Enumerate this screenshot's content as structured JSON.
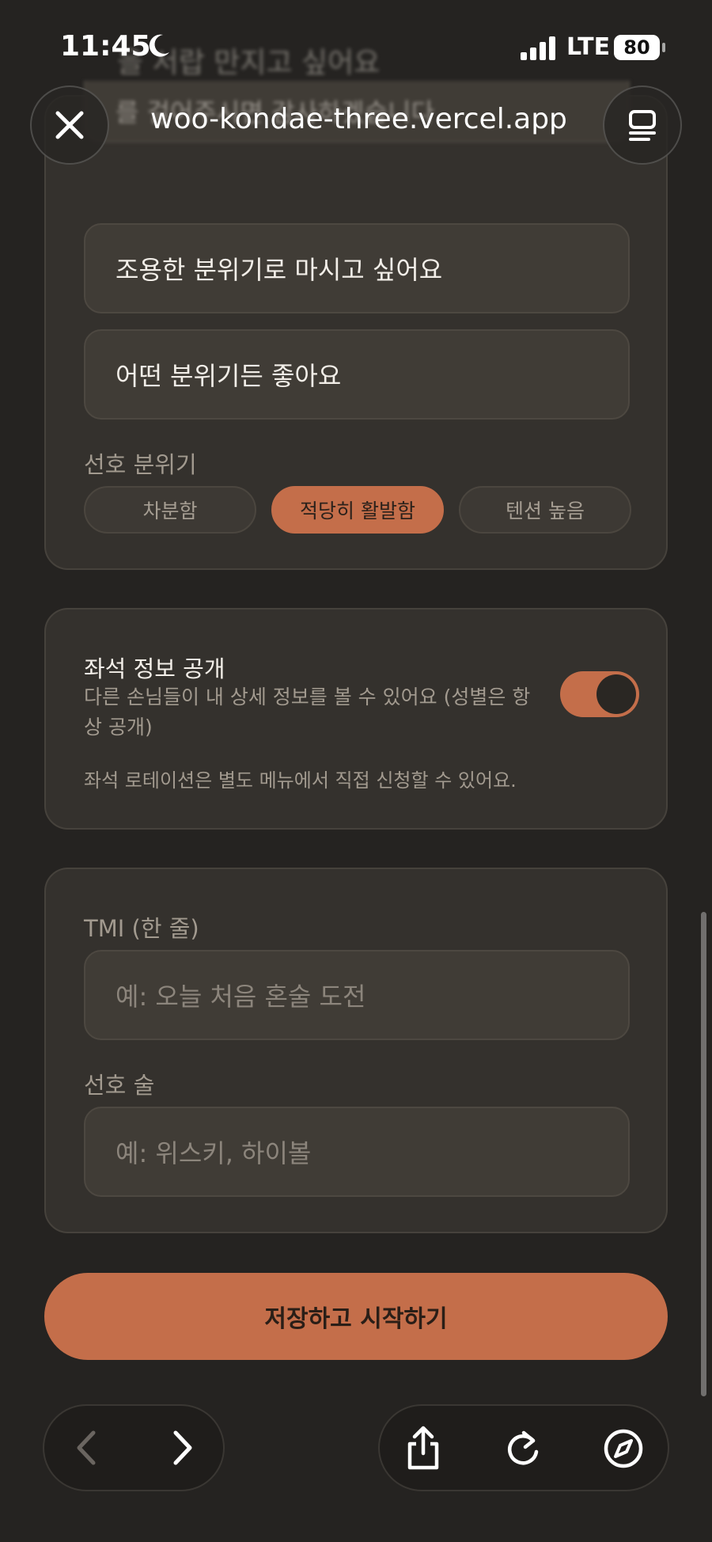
{
  "status_bar": {
    "time": "11:45",
    "network": "LTE",
    "battery": "80"
  },
  "browser": {
    "url": "woo-kondae-three.vercel.app"
  },
  "background_text": {
    "line1": "을 서랍 만지고 싶어요",
    "line2": "를 걸어주시면 감사하겠습니다"
  },
  "drink_mood_options": [
    "조용한 분위기로 마시고 싶어요",
    "어떤 분위기든 좋아요"
  ],
  "preferred_atmosphere": {
    "label": "선호 분위기",
    "options": [
      "차분함",
      "적당히 활발함",
      "텐션 높음"
    ],
    "selected": "적당히 활발함"
  },
  "seat_info": {
    "title": "좌석 정보 공개",
    "description": "다른 손님들이 내 상세 정보를 볼 수 있어요 (성별은 항상 공개)",
    "enabled": true,
    "note": "좌석 로테이션은 별도 메뉴에서 직접 신청할 수 있어요."
  },
  "profile": {
    "tmi_label": "TMI (한 줄)",
    "tmi_placeholder": "예: 오늘 처음 혼술 도전",
    "drink_label": "선호 술",
    "drink_placeholder": "예: 위스키, 하이볼"
  },
  "submit_label": "저장하고 시작하기",
  "colors": {
    "accent": "#c46e4a",
    "card": "#34312d",
    "background": "#252321"
  },
  "icons": {
    "close": "close-icon",
    "tabs": "tabs-icon",
    "back": "chevron-left-icon",
    "forward": "chevron-right-icon",
    "share": "share-icon",
    "reload": "reload-icon",
    "compass": "compass-icon"
  }
}
